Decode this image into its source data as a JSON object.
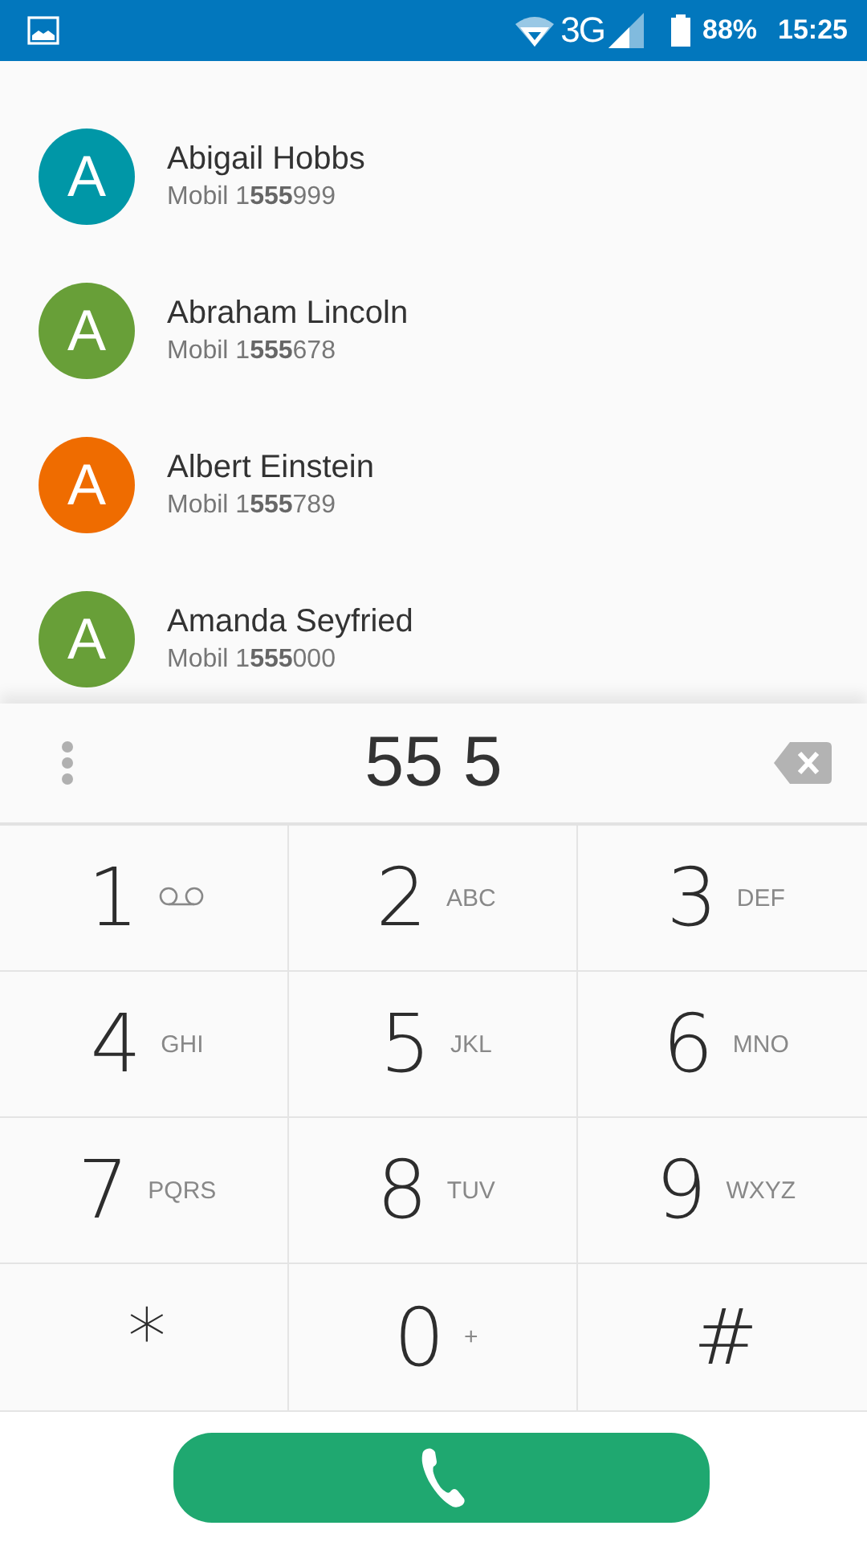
{
  "status_bar": {
    "network": "3G",
    "battery": "88%",
    "time": "15:25"
  },
  "contacts": [
    {
      "initial": "A",
      "name": "Abigail Hobbs",
      "phone": "Mobil 1**555**999",
      "color": "#0097a7"
    },
    {
      "initial": "A",
      "name": "Abraham Lincoln",
      "phone": "Mobil 1**555**678",
      "color": "#689f38"
    },
    {
      "initial": "A",
      "name": "Albert Einstein",
      "phone": "Mobil 1**555**789",
      "color": "#ef6c00"
    },
    {
      "initial": "A",
      "name": "Amanda Seyfried",
      "phone": "Mobil 1**555**000",
      "color": "#689f38"
    }
  ],
  "dialer": {
    "number": "55 5"
  },
  "keypad": [
    {
      "digit": "1",
      "kind": "voicemail"
    },
    {
      "digit": "2",
      "kind": "letters",
      "letters": "ABC"
    },
    {
      "digit": "3",
      "kind": "letters",
      "letters": "DEF"
    },
    {
      "digit": "4",
      "kind": "letters",
      "letters": "GHI"
    },
    {
      "digit": "5",
      "kind": "letters",
      "letters": "JKL"
    },
    {
      "digit": "6",
      "kind": "letters",
      "letters": "MNO"
    },
    {
      "digit": "7",
      "kind": "letters",
      "letters": "PQRS"
    },
    {
      "digit": "8",
      "kind": "letters",
      "letters": "TUV"
    },
    {
      "digit": "9",
      "kind": "letters",
      "letters": "WXYZ"
    },
    {
      "digit": "*",
      "kind": "symbol"
    },
    {
      "digit": "0",
      "kind": "letters",
      "letters": "+"
    },
    {
      "digit": "#",
      "kind": "symbol"
    }
  ]
}
